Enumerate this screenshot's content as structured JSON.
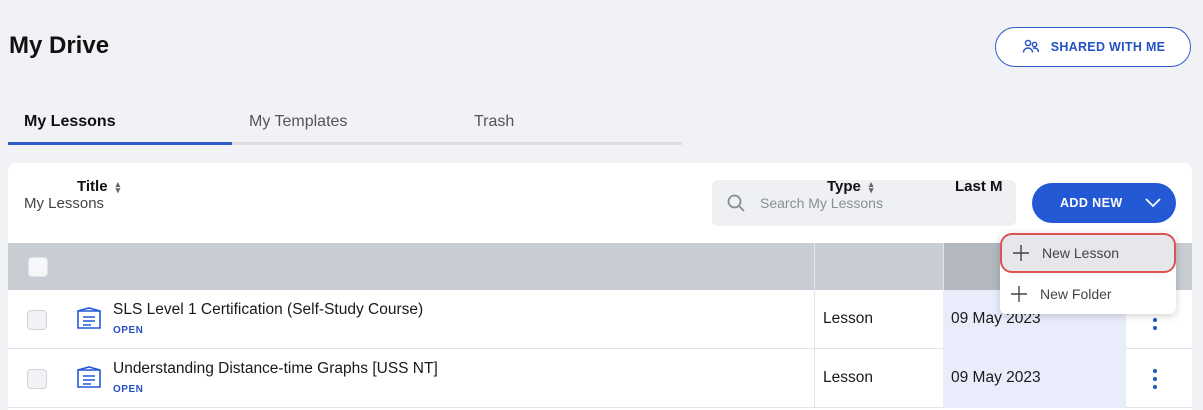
{
  "page": {
    "title": "My Drive"
  },
  "header": {
    "shared_label": "SHARED WITH ME"
  },
  "tabs": [
    {
      "label": "My Lessons",
      "active": true
    },
    {
      "label": "My Templates",
      "active": false
    },
    {
      "label": "Trash",
      "active": false
    }
  ],
  "panel": {
    "label": "My Lessons",
    "search_placeholder": "Search My Lessons",
    "add_label": "ADD NEW"
  },
  "table": {
    "columns": [
      "Title",
      "Type",
      "Last M"
    ],
    "rows": [
      {
        "title": "SLS Level 1 Certification (Self-Study Course)",
        "status": "OPEN",
        "type": "Lesson",
        "modified": "09 May 2023"
      },
      {
        "title": "Understanding Distance-time Graphs [USS NT]",
        "status": "OPEN",
        "type": "Lesson",
        "modified": "09 May 2023"
      }
    ]
  },
  "dropdown": {
    "items": [
      {
        "label": "New Lesson",
        "icon": "plus-icon"
      },
      {
        "label": "New Folder",
        "icon": "plus-icon"
      }
    ]
  },
  "colors": {
    "accent": "#2459d6",
    "highlight_outline": "#d9534f"
  }
}
